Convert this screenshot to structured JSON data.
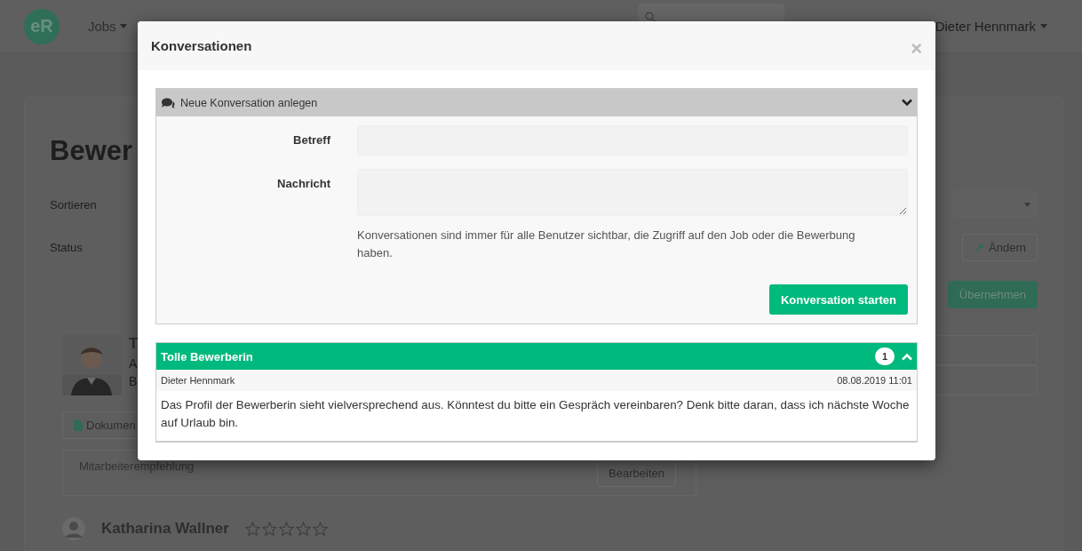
{
  "navbar": {
    "logo": "eR",
    "menu": "Jobs",
    "user_name": "Dieter Hennmark"
  },
  "page": {
    "title": "Bewer",
    "sort_label": "Sortieren",
    "status_label": "Status",
    "change_button": "Ändern",
    "apply_button": "Übernehmen",
    "candidate": {
      "name": "T",
      "lines": [
        "A",
        "B"
      ],
      "documents_button": "Dokumen",
      "referral_label": "Mitarbeiterempfehlung",
      "edit_button": "Bearbeiten"
    },
    "next_candidate": {
      "name": "Katharina Wallner",
      "stars": 0
    }
  },
  "modal": {
    "title": "Konversationen",
    "close": "×",
    "new_conversation": {
      "title": "Neue Konversation anlegen",
      "fields": [
        {
          "label": "Betreff",
          "kind": "input"
        },
        {
          "label": "Nachricht",
          "kind": "textarea"
        }
      ],
      "hint": "Konversationen sind immer für alle Benutzer sichtbar, die Zugriff auf den Job oder die Bewerbung haben.",
      "submit": "Konversation starten"
    },
    "conversations": [
      {
        "subject": "Tolle Bewerberin",
        "count": "1",
        "author": "Dieter Hennmark",
        "time": "08.08.2019 11:01",
        "message": "Das Profil der Bewerberin sieht vielversprechend aus. Könntest du bitte ein Gespräch vereinbaren? Denk bitte daran, dass ich nächste Woche auf Urlaub bin."
      }
    ]
  }
}
